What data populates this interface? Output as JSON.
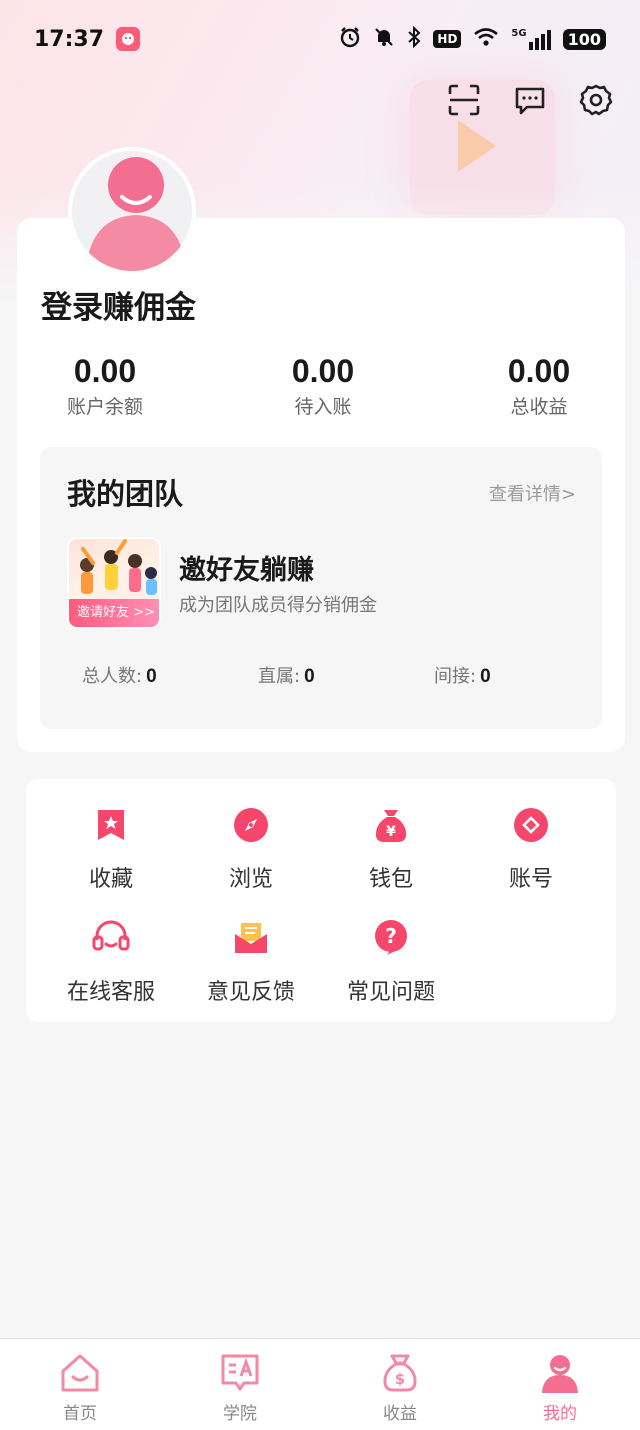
{
  "status_bar": {
    "time": "17:37",
    "network": "5G",
    "hd": "HD",
    "battery": "100"
  },
  "header": {
    "icons": [
      "scan-icon",
      "message-icon",
      "settings-icon"
    ]
  },
  "profile": {
    "login_text": "登录赚佣金"
  },
  "stats": [
    {
      "value": "0.00",
      "label": "账户余额"
    },
    {
      "value": "0.00",
      "label": "待入账"
    },
    {
      "value": "0.00",
      "label": "总收益"
    }
  ],
  "team": {
    "title": "我的团队",
    "detail_link": "查看详情>",
    "invite_badge": "邀请好友 >>",
    "invite_title": "邀好友躺赚",
    "invite_subtitle": "成为团队成员得分销佣金",
    "counts": [
      {
        "label": "总人数:",
        "value": "0"
      },
      {
        "label": "直属:",
        "value": "0"
      },
      {
        "label": "间接:",
        "value": "0"
      }
    ]
  },
  "services": [
    {
      "label": "收藏",
      "icon": "bookmark-icon"
    },
    {
      "label": "浏览",
      "icon": "compass-icon"
    },
    {
      "label": "钱包",
      "icon": "money-bag-icon"
    },
    {
      "label": "账号",
      "icon": "account-icon"
    },
    {
      "label": "在线客服",
      "icon": "headset-icon"
    },
    {
      "label": "意见反馈",
      "icon": "envelope-icon"
    },
    {
      "label": "常见问题",
      "icon": "question-icon"
    }
  ],
  "tabbar": {
    "tabs": [
      {
        "label": "首页",
        "icon": "home-icon"
      },
      {
        "label": "学院",
        "icon": "academy-icon"
      },
      {
        "label": "收益",
        "icon": "earnings-icon"
      },
      {
        "label": "我的",
        "icon": "profile-icon"
      }
    ],
    "active_index": 3
  },
  "colors": {
    "accent": "#f4476b",
    "active_tab": "#f46e91",
    "tab_icon": "#f28aa5"
  }
}
